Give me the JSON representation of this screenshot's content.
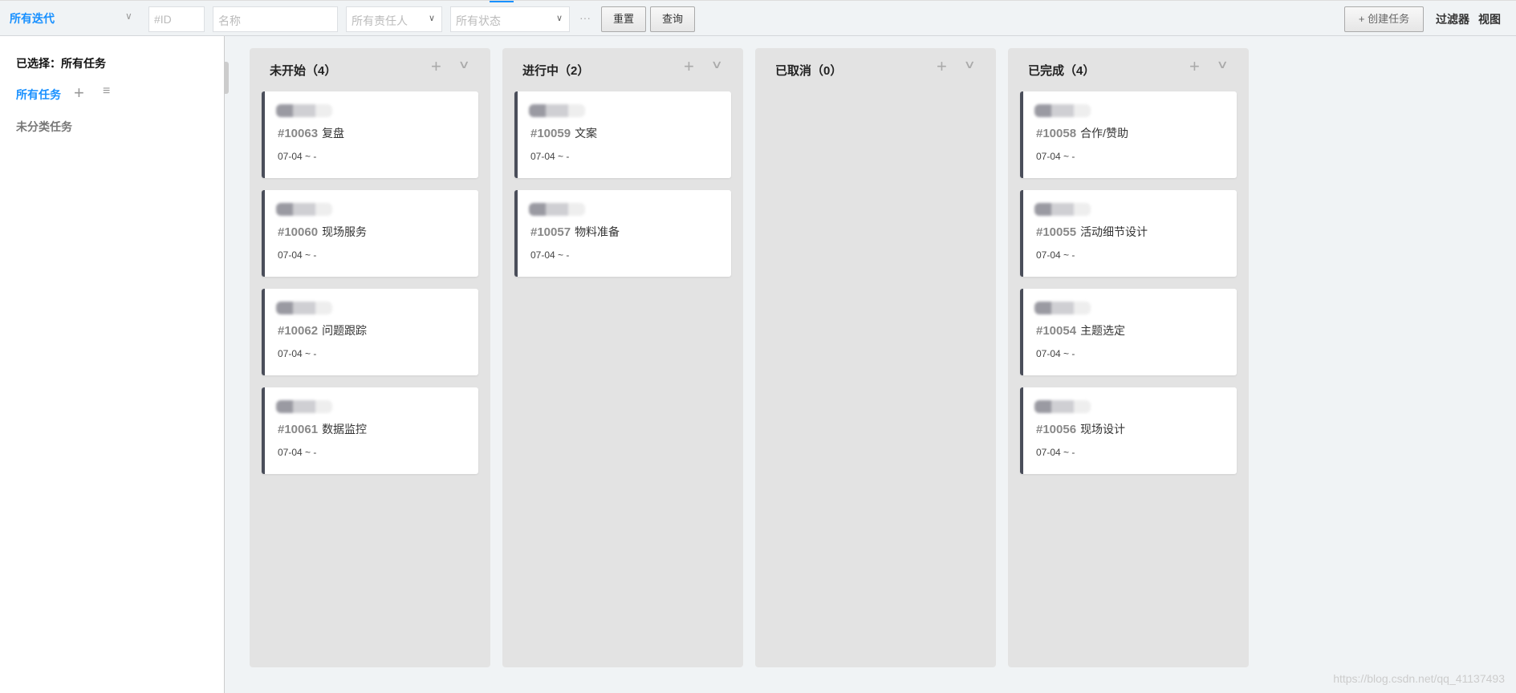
{
  "toolbar": {
    "iteration": "所有迭代",
    "id_placeholder": "#ID",
    "name_placeholder": "名称",
    "assignee": "所有责任人",
    "status": "所有状态",
    "more": "···",
    "reset": "重置",
    "query": "查询",
    "create": "+  创建任务",
    "filter": "过滤器",
    "view": "视图"
  },
  "sidebar": {
    "selected_label": "已选择：",
    "selected_value": "所有任务",
    "all_tasks": "所有任务",
    "uncategorized": "未分类任务"
  },
  "columns": [
    {
      "title": "未开始（4）",
      "cards": [
        {
          "id": "#10063",
          "name": "复盘",
          "date": "07-04 ~ -"
        },
        {
          "id": "#10060",
          "name": "现场服务",
          "date": "07-04 ~ -"
        },
        {
          "id": "#10062",
          "name": "问题跟踪",
          "date": "07-04 ~ -"
        },
        {
          "id": "#10061",
          "name": "数据监控",
          "date": "07-04 ~ -"
        }
      ]
    },
    {
      "title": "进行中（2）",
      "cards": [
        {
          "id": "#10059",
          "name": "文案",
          "date": "07-04 ~ -"
        },
        {
          "id": "#10057",
          "name": "物料准备",
          "date": "07-04 ~ -"
        }
      ]
    },
    {
      "title": "已取消（0）",
      "cards": []
    },
    {
      "title": "已完成（4）",
      "cards": [
        {
          "id": "#10058",
          "name": "合作/赞助",
          "date": "07-04 ~ -"
        },
        {
          "id": "#10055",
          "name": "活动细节设计",
          "date": "07-04 ~ -"
        },
        {
          "id": "#10054",
          "name": "主题选定",
          "date": "07-04 ~ -"
        },
        {
          "id": "#10056",
          "name": "现场设计",
          "date": "07-04 ~ -"
        }
      ]
    }
  ],
  "watermark": "https://blog.csdn.net/qq_41137493"
}
